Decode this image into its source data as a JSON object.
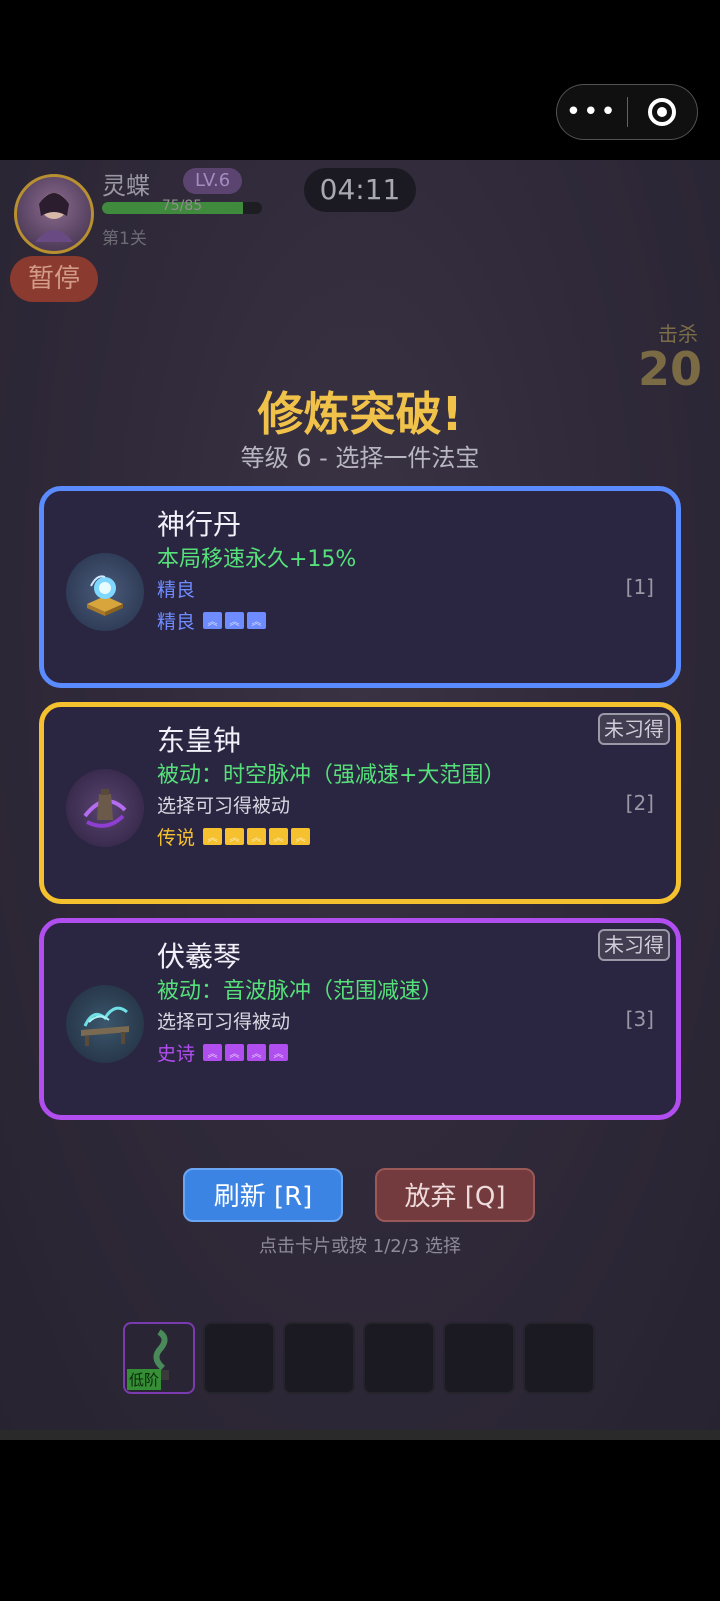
{
  "player": {
    "name": "灵蝶",
    "level": "LV.6",
    "hp_text": "75/85",
    "hp_fraction": 0.88,
    "stage": "第1关"
  },
  "hud": {
    "pause_label": "暂停",
    "timer": "04:11",
    "kill_label": "击杀",
    "kill_count": "20"
  },
  "levelup": {
    "title": "修炼突破!",
    "subtitle": "等级 6 - 选择一件法宝"
  },
  "cards": [
    {
      "name": "神行丹",
      "effect": "本局移速永久+15%",
      "desc": "精良",
      "rarity": "精良",
      "stars": 3,
      "key": "[1]",
      "icon": "pill-icon",
      "border_color": "#5a8cff",
      "rarity_color": "#6e8cff",
      "star_color": "#6e8cff"
    },
    {
      "name": "东皇钟",
      "effect": "被动：时空脉冲（强减速+大范围）",
      "desc": "选择可习得被动",
      "rarity": "传说",
      "stars": 5,
      "key": "[2]",
      "badge": "未习得",
      "icon": "bell-icon",
      "border_color": "#f6c12e",
      "rarity_color": "#f6c12e",
      "star_color": "#f6c12e"
    },
    {
      "name": "伏羲琴",
      "effect": "被动：音波脉冲（范围减速）",
      "desc": "选择可习得被动",
      "rarity": "史诗",
      "stars": 4,
      "key": "[3]",
      "badge": "未习得",
      "icon": "guqin-icon",
      "border_color": "#b14ef0",
      "rarity_color": "#b14ef0",
      "star_color": "#b14ef0"
    }
  ],
  "actions": {
    "refresh_label": "刷新 [R]",
    "discard_label": "放弃 [Q]",
    "hint": "点击卡片或按 1/2/3 选择"
  },
  "inventory": {
    "slots": 6,
    "first_slot_tag": "低阶"
  },
  "colors": {
    "title": "#f1c24a",
    "effect_text": "#55e07a",
    "refresh_button": "#3b84e4",
    "discard_button": "#743b3e"
  }
}
